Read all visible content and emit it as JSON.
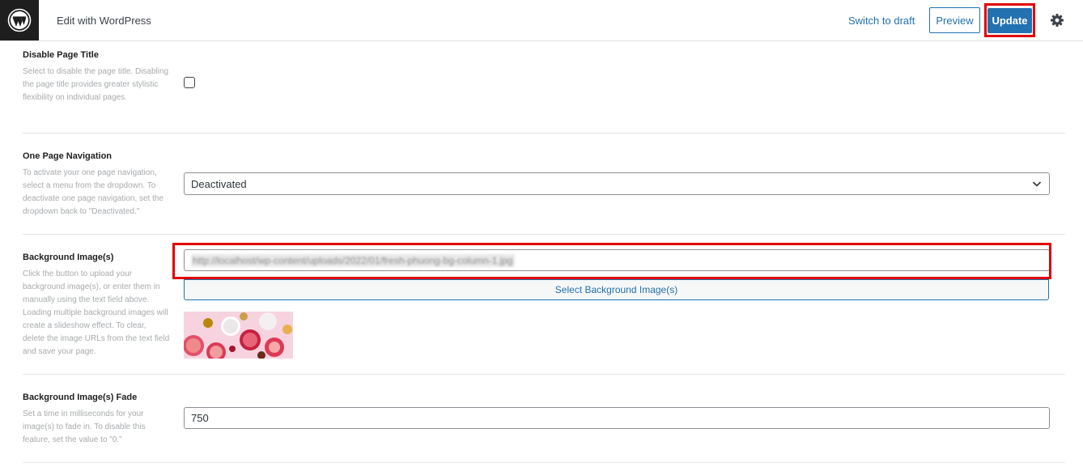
{
  "header": {
    "app_title": "Edit with WordPress",
    "switch_to_draft_label": "Switch to draft",
    "preview_label": "Preview",
    "update_label": "Update"
  },
  "settings": {
    "disable_page_title": {
      "label": "Disable Page Title",
      "description": "Select to disable the page title. Disabling the page title provides greater stylistic flexibility on individual pages.",
      "checked": false
    },
    "one_page_navigation": {
      "label": "One Page Navigation",
      "description": "To activate your one page navigation, select a menu from the dropdown. To deactivate one page navigation, set the dropdown back to \"Deactivated.\"",
      "selected": "Deactivated"
    },
    "background_images": {
      "label": "Background Image(s)",
      "description": "Click the button to upload your background image(s), or enter them in manually using the text field above. Loading multiple background images will create a slideshow effect. To clear, delete the image URLs from the text field and save your page.",
      "url_value": "http://localhost/wp-content/uploads/2022/01/fresh-phuong-bg-column-1.jpg",
      "select_button_label": "Select Background Image(s)"
    },
    "background_fade": {
      "label": "Background Image(s) Fade",
      "description": "Set a time in milliseconds for your image(s) to fade in. To disable this feature, set the value to \"0.\"",
      "value": "750"
    }
  },
  "colors": {
    "accent": "#2271b1",
    "highlight": "#e00000",
    "dark": "#1e1e1e"
  },
  "icons": {
    "logo": "wordpress-logo-icon",
    "settings": "gear-icon",
    "dropdown": "chevron-down-icon"
  }
}
